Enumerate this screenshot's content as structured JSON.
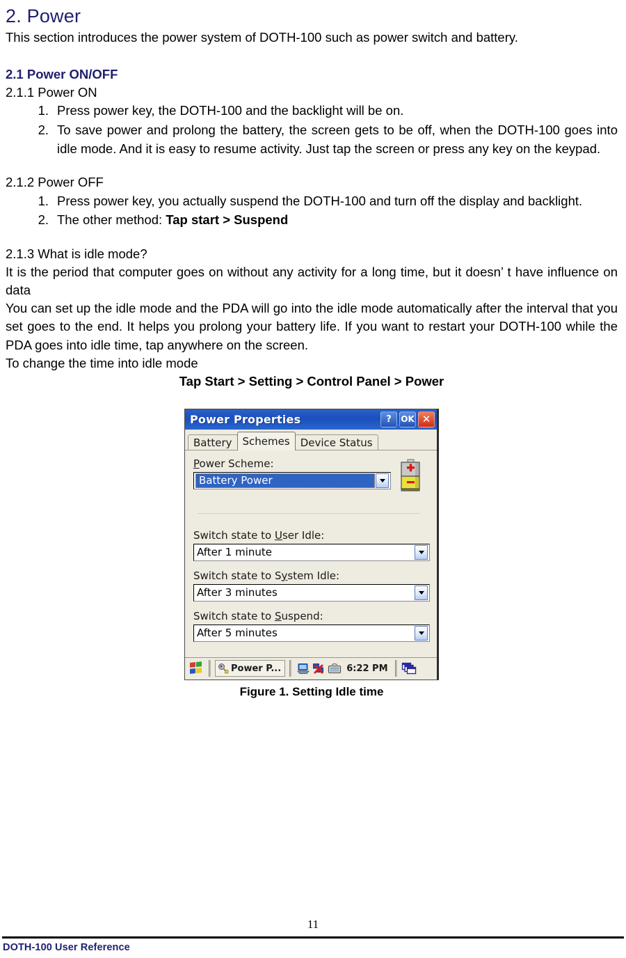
{
  "document": {
    "heading": "2. Power",
    "intro": "This section introduces the power system of DOTH-100 such as power switch and battery.",
    "section_on_off": {
      "heading": "2.1 Power ON/OFF",
      "power_on": {
        "heading": "2.1.1 Power ON",
        "items": [
          "Press power key, the DOTH-100 and the backlight will be on.",
          "To save power and prolong the battery, the screen gets to be off, when the DOTH-100 goes into idle mode. And it is easy to resume activity. Just tap the screen or press any key on the keypad."
        ]
      },
      "power_off": {
        "heading": "2.1.2 Power OFF",
        "item1": "Press power key, you actually suspend the DOTH-100 and turn off the display and backlight.",
        "item2_prefix": "The other method: ",
        "item2_bold": "Tap start > Suspend"
      },
      "idle_mode": {
        "heading": "2.1.3 What is idle mode?",
        "para1": "It is the period that computer goes on without any activity for a long time, but it doesn’ t have influence on data",
        "para2": "You can set up the idle mode and the PDA will go into the idle mode automatically after the interval that you set goes to the end. It helps you prolong your battery life. If you want to restart your DOTH-100 while the PDA goes into idle time, tap anywhere on the screen.",
        "para3": "To change the time into idle mode",
        "path": "Tap Start > Setting > Control Panel > Power"
      }
    },
    "figure": {
      "caption": "Figure 1. Setting Idle time"
    },
    "footer": {
      "page_number": "11",
      "text": "DOTH-100 User Reference"
    }
  },
  "screenshot": {
    "window": {
      "title": "Power Properties",
      "buttons": {
        "help": "?",
        "ok": "OK",
        "close": "✕"
      }
    },
    "tabs": [
      {
        "label": "Battery",
        "active": false
      },
      {
        "label": "Schemes",
        "active": true
      },
      {
        "label": "Device Status",
        "active": false
      }
    ],
    "fields": {
      "power_scheme": {
        "label_pre": "",
        "label_accel": "P",
        "label_post": "ower Scheme:",
        "value": "Battery Power"
      },
      "user_idle": {
        "label_pre": "Switch state to ",
        "label_accel": "U",
        "label_post": "ser Idle:",
        "value": "After 1 minute"
      },
      "system_idle": {
        "label_pre": "Switch state to S",
        "label_accel": "y",
        "label_post": "stem Idle:",
        "value": "After 3 minutes"
      },
      "suspend": {
        "label_pre": "Switch state to ",
        "label_accel": "S",
        "label_post": "uspend:",
        "value": "After 5 minutes"
      }
    },
    "taskbar": {
      "start_icon": "windows-flag-icon",
      "task_button_label": "Power P...",
      "tray_icons": [
        "desktop-icon",
        "network-disconnected-icon",
        "keyboard-sip-icon"
      ],
      "clock": "6:22 PM",
      "window_list_icon": "cascade-windows-icon"
    },
    "colors": {
      "title_bar": "#1b4fbd",
      "dialog_face": "#eeebe0",
      "selection": "#2f63c4",
      "close_button": "#cf2d16",
      "heading_blue": "#1f1f6e"
    }
  }
}
